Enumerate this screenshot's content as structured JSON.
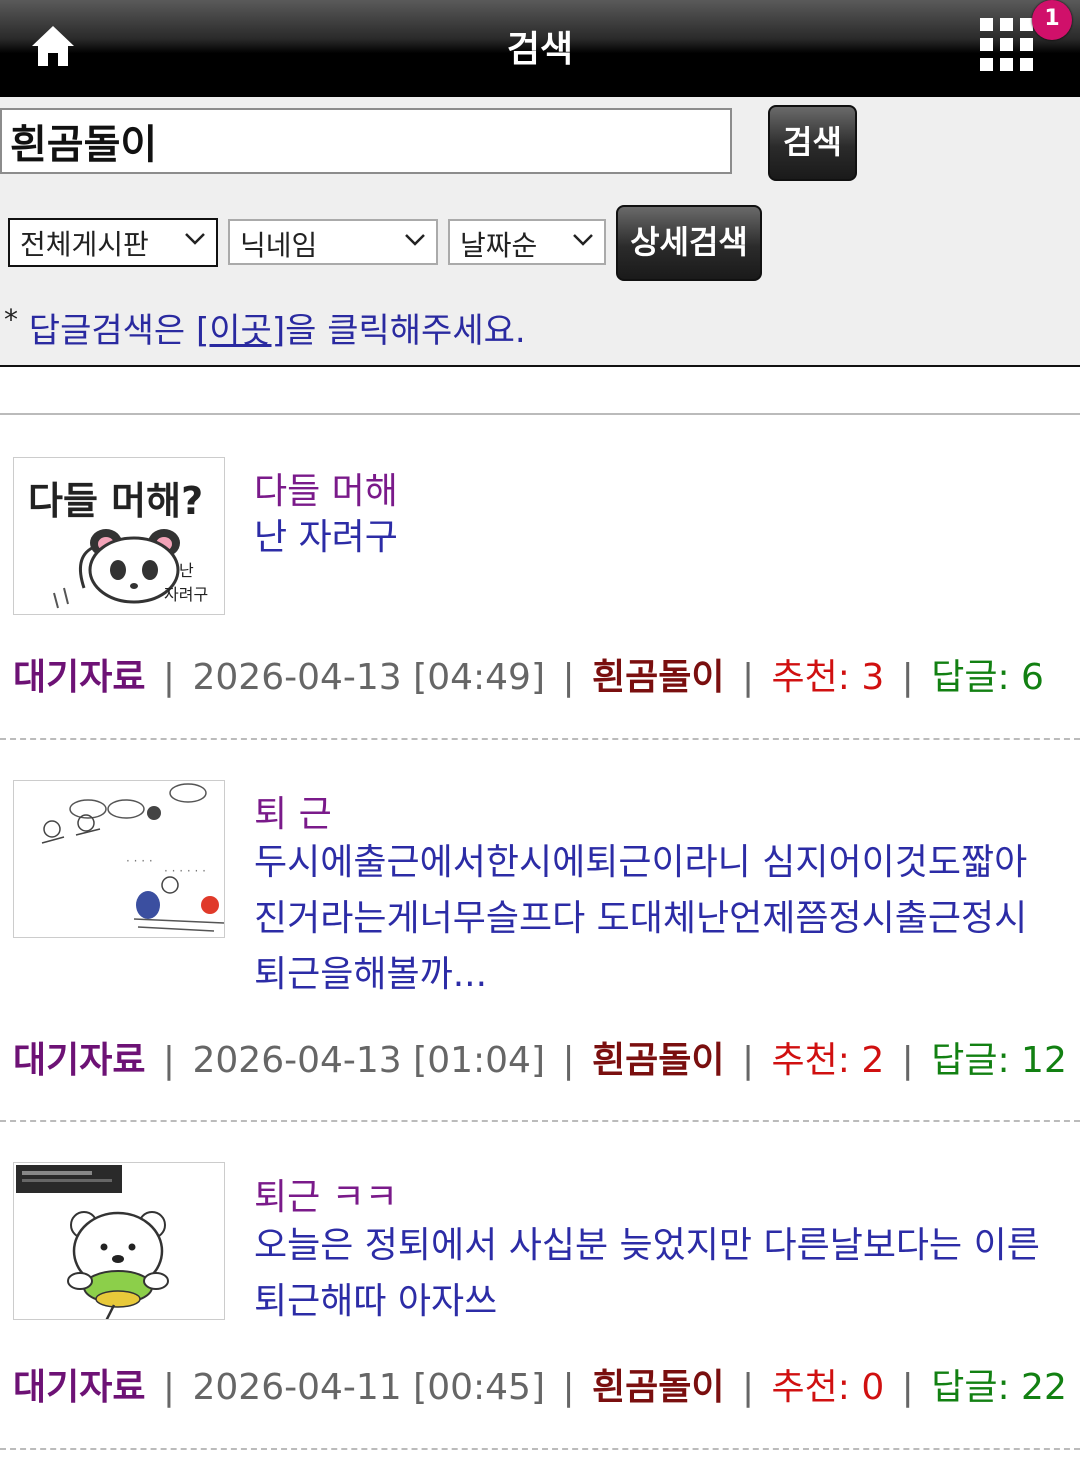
{
  "header": {
    "title": "검색",
    "notification_count": "1"
  },
  "search": {
    "query": "흰곰돌이",
    "button_label": "검색",
    "detail_button_label": "상세검색",
    "board_select": "전체게시판",
    "field_select": "닉네임",
    "order_select": "날짜순"
  },
  "reply_hint": {
    "star": "*",
    "before": " 답글검색은 ",
    "link": "[이곳]",
    "after": "을 클릭해주세요."
  },
  "posts": [
    {
      "title": "다들 머해",
      "body": "난 자려구",
      "board": "대기자료",
      "date": "2026-04-13 [04:49]",
      "author": "흰곰돌이",
      "recommend": "추천: 3",
      "replies": "답글: 6",
      "thumb_text": [
        "다들 머해?",
        "난",
        "자려구"
      ]
    },
    {
      "title": "퇴 근",
      "body": "두시에출근에서한시에퇴근이라니 심지어이것도짧아진거라는게너무슬프다 도대체난언제쯤정시출근정시퇴근을해볼까...",
      "board": "대기자료",
      "date": "2026-04-13 [01:04]",
      "author": "흰곰돌이",
      "recommend": "추천: 2",
      "replies": "답글: 12"
    },
    {
      "title": "퇴근 ㅋㅋ",
      "body": "오늘은 정퇴에서 사십분 늦었지만 다른날보다는 이른 퇴근해따 아자쓰",
      "board": "대기자료",
      "date": "2026-04-11 [00:45]",
      "author": "흰곰돌이",
      "recommend": "추천: 0",
      "replies": "답글: 22"
    }
  ]
}
